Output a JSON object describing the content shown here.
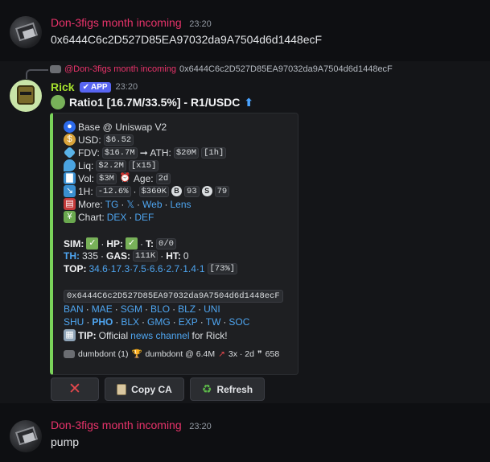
{
  "messages": {
    "first": {
      "username": "Don-3figs month incoming",
      "time": "23:20",
      "text": "0x6444C6c2D527D85EA97032da9A7504d6d1448ecF"
    },
    "last": {
      "username": "Don-3figs month incoming",
      "time": "23:20",
      "text": "pump"
    }
  },
  "reply": {
    "mention": "@Don-3figs month incoming",
    "text": "0x6444C6c2D527D85EA97032da9A7504d6d1448ecF"
  },
  "bot": {
    "name": "Rick",
    "badge": "APP",
    "time": "23:20",
    "title": "Ratio1 [16.7M/33.5%] - R1/USDC",
    "title_arrow": "⬆"
  },
  "embed": {
    "chain": "Base @ Uniswap V2",
    "usd_label": "USD:",
    "usd_value": "$6.52",
    "fdv_label": "FDV:",
    "fdv_value": "$16.7M",
    "ath_label": "➞ ATH:",
    "ath_value": "$20M",
    "ath_age": "[1h]",
    "liq_label": "Liq:",
    "liq_value": "$2.2M",
    "liq_mult": "[x15]",
    "vol_label": "Vol:",
    "vol_value": "$3M",
    "age_label": "Age:",
    "age_value": "2d",
    "h1_label": "1H:",
    "h1_change": "-12.6%",
    "h1_vol": "$360K",
    "h1_buys": "93",
    "h1_sells": "79",
    "more_label": "More:",
    "more_links": [
      "TG",
      "𝕏",
      "Web",
      "Lens"
    ],
    "chart_label": "Chart:",
    "chart_links": [
      "DEX",
      "DEF"
    ],
    "sim_label": "SIM:",
    "hp_label": "HP:",
    "t_label": "T:",
    "t_value": "0/0",
    "th_label": "TH:",
    "th_value": "335",
    "gas_label": "GAS:",
    "gas_value": "111K",
    "ht_label": "HT:",
    "ht_value": "0",
    "top_label": "TOP:",
    "top_values": "34.6·17.3·7.5·6.6·2.7·1.4·1",
    "top_total": "[73%]",
    "contract": "0x6444C6c2D527D85EA97032da9A7504d6d1448ecF",
    "bots_row1": [
      "BAN",
      "MAE",
      "SGM",
      "BLO",
      "BLZ",
      "UNI"
    ],
    "bots_row2": [
      "SHU",
      "PHO",
      "BLX",
      "GMG",
      "EXP",
      "TW",
      "SOC"
    ],
    "tip_label": "TIP:",
    "tip_pre": "Official",
    "tip_link": "news channel",
    "tip_post": "for Rick!",
    "footer": {
      "user1": "dumbdont (1)",
      "user2": "dumbdont @ 6.4M",
      "mult": "3x · 2d",
      "quote": "658"
    }
  },
  "buttons": {
    "copy": "Copy CA",
    "refresh": "Refresh"
  },
  "colors": {
    "accent_green": "#7ad35a",
    "link": "#4ea5f0",
    "username": "#e8336a",
    "badge": "#5865f2"
  }
}
